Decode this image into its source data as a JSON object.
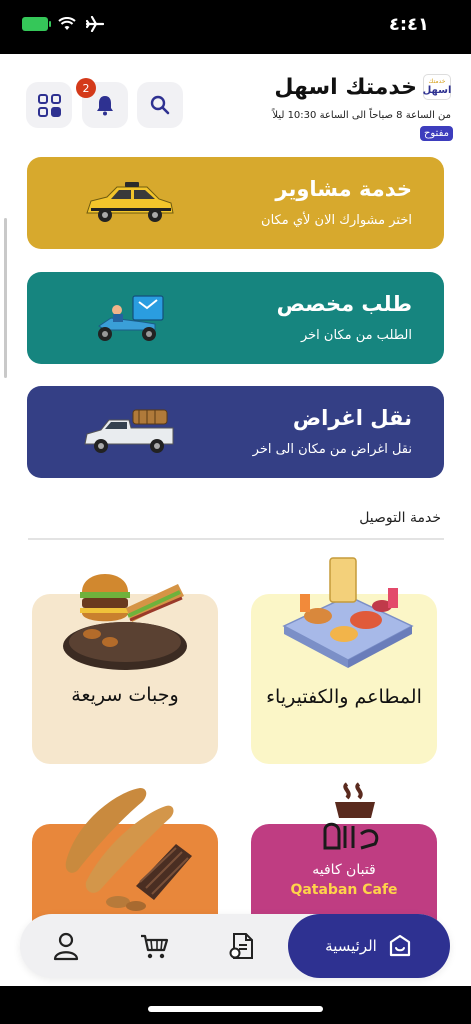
{
  "status_bar": {
    "time": "٤:٤١"
  },
  "header": {
    "brand_logo_top": "خدمتك",
    "brand_logo_bottom": "اسهل",
    "title": "خدمتك اسهل",
    "hours": "من الساعة 8 صباحاً الى الساعة 10:30 ليلاً",
    "status": "مفتوح",
    "notification_count": "2"
  },
  "services": [
    {
      "title": "خدمة مشاوير",
      "subtitle": "اختر مشوارك الان لأي مكان",
      "color": "#d7a92d"
    },
    {
      "title": "طلب مخصص",
      "subtitle": "الطلب من مكان اخر",
      "color": "#16857f"
    },
    {
      "title": "نقل اغراض",
      "subtitle": "نقل اغراض من مكان الى اخر",
      "color": "#343f85"
    }
  ],
  "delivery": {
    "section_title": "خدمة التوصيل",
    "categories": [
      {
        "label": "المطاعم والكفتيرياء"
      },
      {
        "label": "وجبات سريعة"
      }
    ],
    "cafe_name_ar": "قتبان كافيه",
    "cafe_name_en": "Qataban Cafe"
  },
  "bottom_nav": {
    "home_label": "الرئيسية"
  },
  "colors": {
    "primary": "#2e3191",
    "gold": "#d7a92d",
    "teal": "#16857f",
    "navy": "#343f85"
  }
}
